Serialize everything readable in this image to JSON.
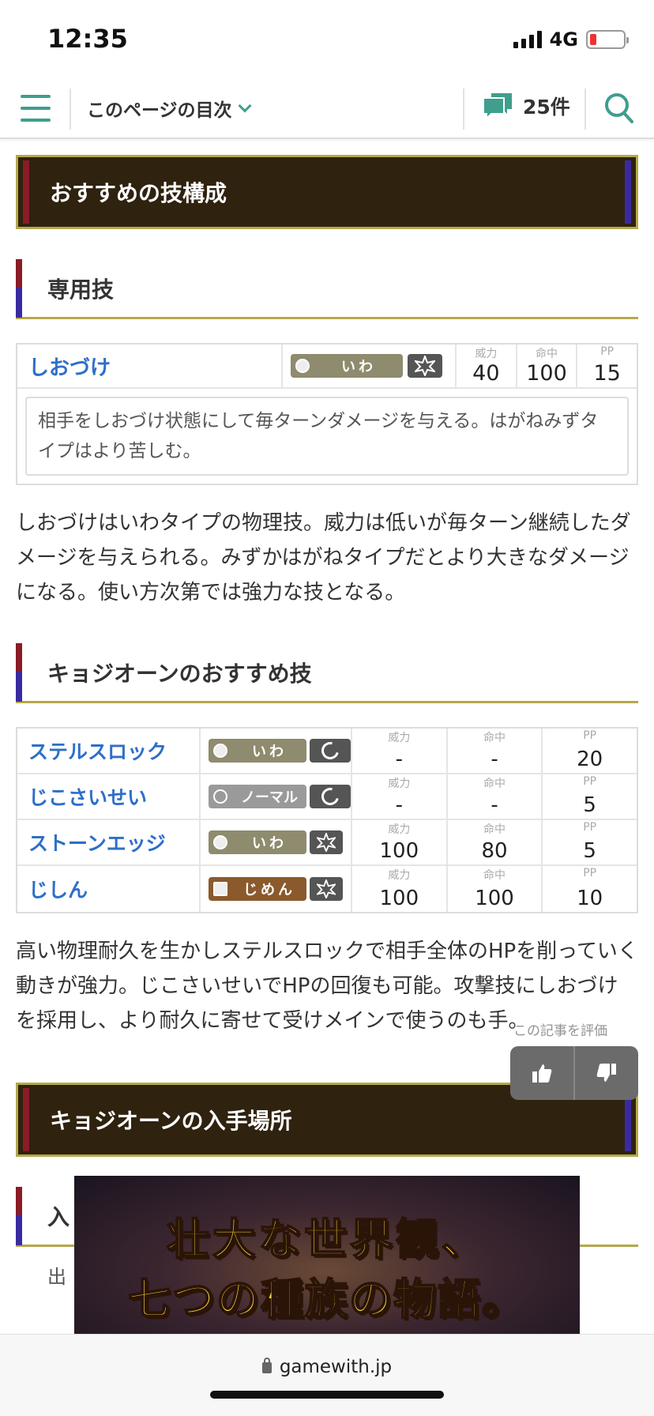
{
  "status_bar": {
    "time": "12:35",
    "network": "4G"
  },
  "nav": {
    "toc_label": "このページの目次",
    "comment_count": "25件"
  },
  "sections": {
    "recommended_moves_title": "おすすめの技構成",
    "exclusive_move_title": "専用技",
    "recommended_moves_sub": "キョジオーンのおすすめ技",
    "acquire_title": "キョジオーンの入手場所",
    "acquire_sub_partial": "入"
  },
  "exclusive_move": {
    "name": "しおづけ",
    "type": "いわ",
    "labels": {
      "power": "威力",
      "accuracy": "命中",
      "pp": "PP"
    },
    "power": "40",
    "accuracy": "100",
    "pp": "15",
    "description": "相手をしおづけ状態にして毎ターンダメージを与える。はがねみずタイプはより苦しむ。"
  },
  "exclusive_move_text": "しおづけはいわタイプの物理技。威力は低いが毎ターン継続したダメージを与えられる。みずかはがねタイプだとより大きなダメージになる。使い方次第では強力な技となる。",
  "moves_table": [
    {
      "name": "ステルスロック",
      "type": "いわ",
      "category": "status",
      "power": "-",
      "accuracy": "-",
      "pp": "20"
    },
    {
      "name": "じこさいせい",
      "type": "ノーマル",
      "category": "status",
      "power": "-",
      "accuracy": "-",
      "pp": "5"
    },
    {
      "name": "ストーンエッジ",
      "type": "いわ",
      "category": "physical",
      "power": "100",
      "accuracy": "80",
      "pp": "5"
    },
    {
      "name": "じしん",
      "type": "じめん",
      "category": "physical",
      "power": "100",
      "accuracy": "100",
      "pp": "10"
    }
  ],
  "moves_text": "高い物理耐久を生かしステルスロックで相手全体のHPを削っていく動きが強力。じこさいせいでHPの回復も可能。攻撃技にしおづけを採用し、より耐久に寄せて受けメインで使うのも手。",
  "vote_label": "この記事を評価",
  "ad": {
    "line1": "壮大な世界観、",
    "line2": "七つの種族の物語。"
  },
  "acquire_item_partial": "出",
  "url": "gamewith.jp",
  "colors": {
    "accent": "#3f9e8c",
    "link": "#2d6fc9",
    "heading_bg": "#2f220f",
    "heading_border": "#b5a84a",
    "rock_type": "#8e8b6e",
    "normal_type": "#9a9a9a",
    "ground_type": "#8a5a2c"
  }
}
